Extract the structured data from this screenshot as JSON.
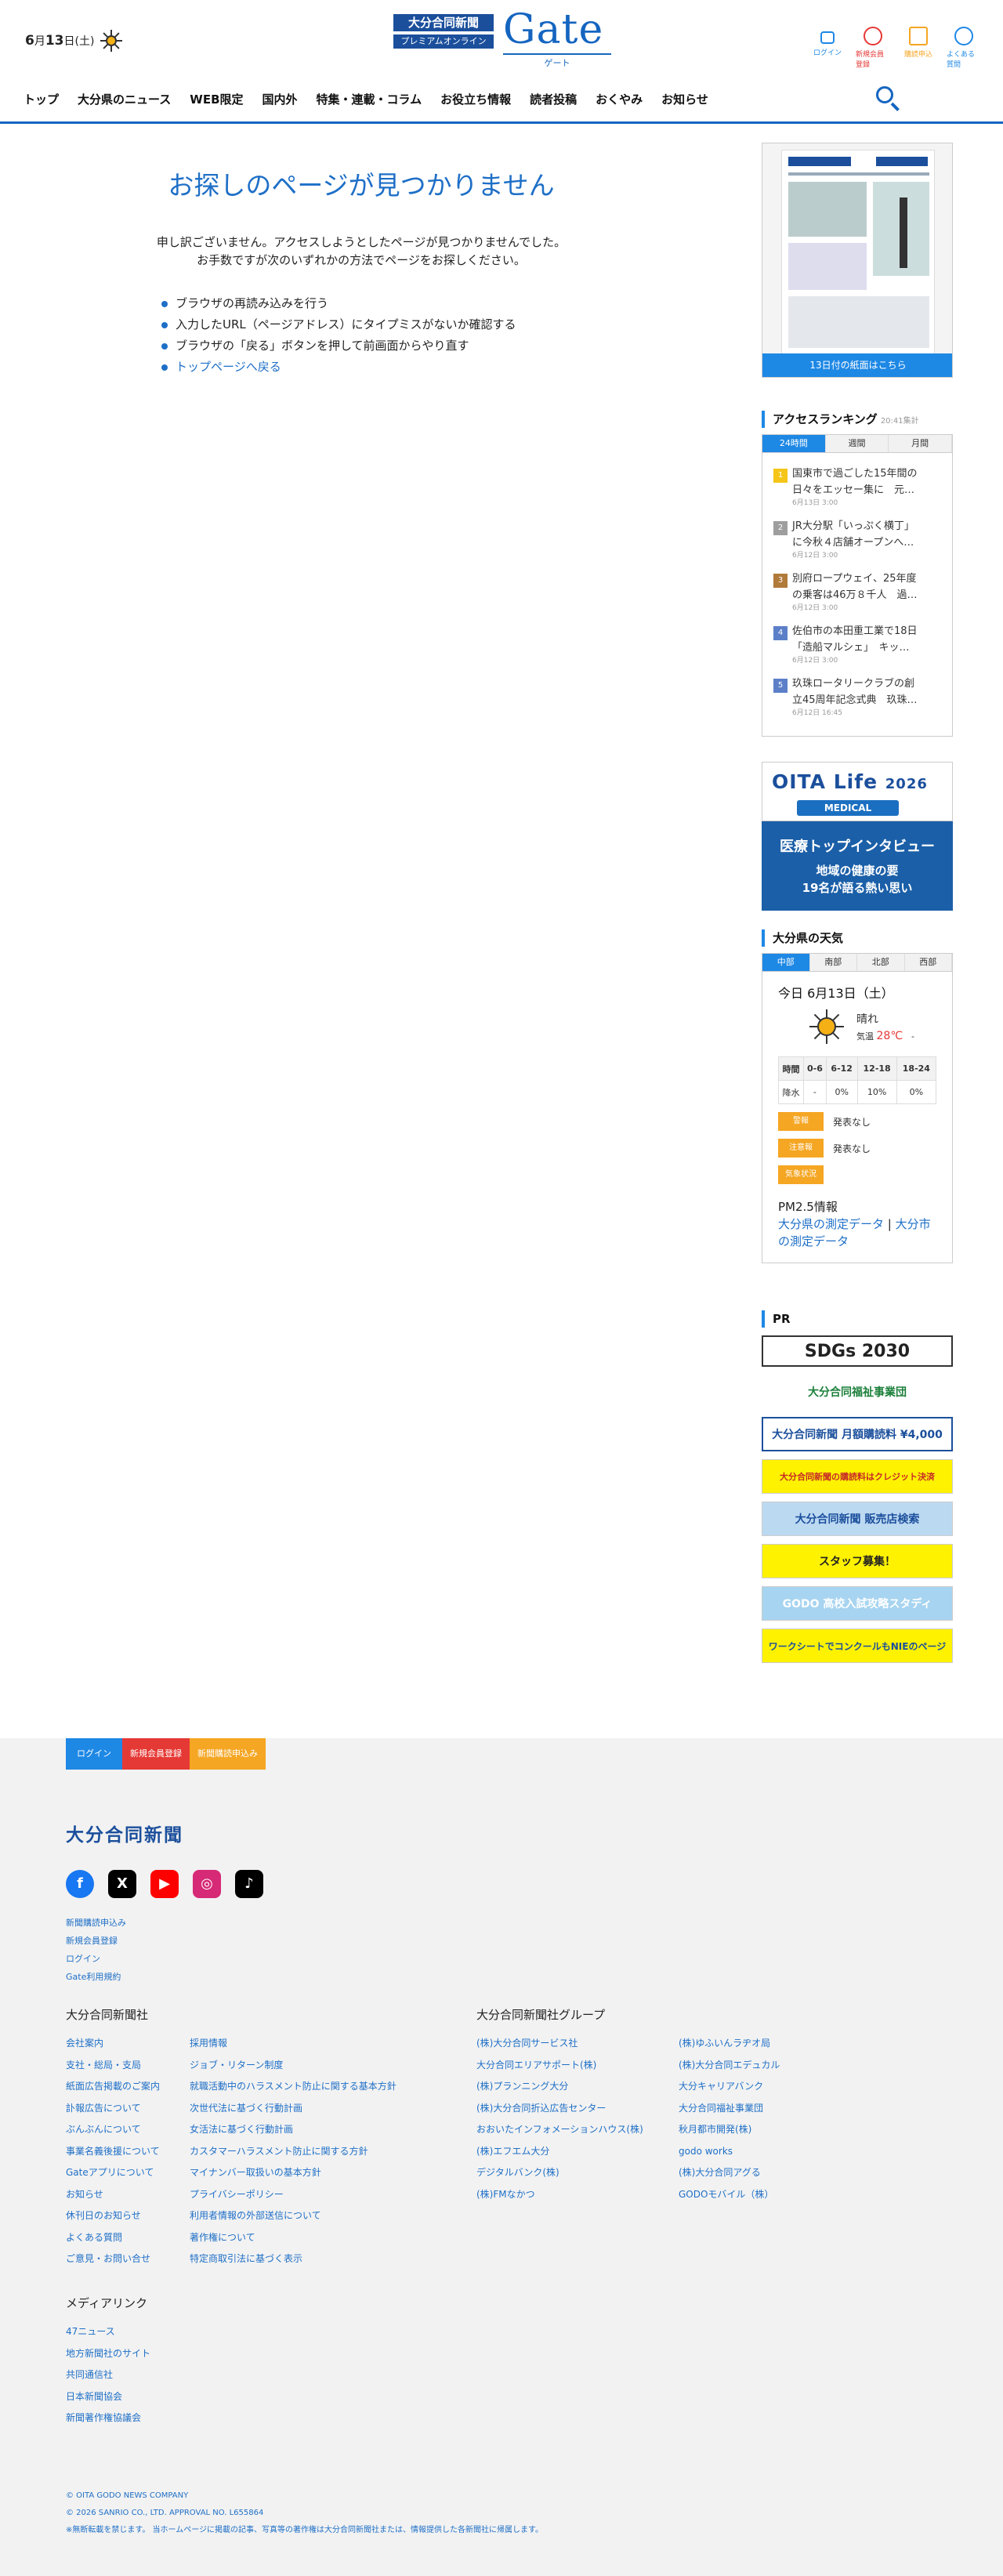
{
  "header": {
    "date_month": "6",
    "date_month_unit": "月",
    "date_day": "13",
    "date_day_unit": "日",
    "date_weekday": "(土)",
    "logo_newspaper": "大分合同新聞",
    "logo_sub": "プレミアムオンライン",
    "logo_gate": "Gate",
    "logo_gate_kana": "ゲート",
    "icons": [
      {
        "label": "ログイン",
        "icon": "lock-icon",
        "color": "#1e88e5"
      },
      {
        "label": "新規会員登録",
        "icon": "check-circle-icon",
        "color": "#e53935"
      },
      {
        "label": "購読申込",
        "icon": "newspaper-icon",
        "color": "#f5a623"
      },
      {
        "label": "よくある質問",
        "icon": "question-icon",
        "color": "#1e88e5"
      }
    ]
  },
  "nav": [
    "トップ",
    "大分県のニュース",
    "WEB限定",
    "国内外",
    "特集・連載・コラム",
    "お役立ち情報",
    "読者投稿",
    "おくやみ",
    "お知らせ"
  ],
  "not_found": {
    "title": "お探しのページが見つかりません",
    "desc_line1": "申し訳ございません。アクセスしようとしたページが見つかりませんでした。",
    "desc_line2": "お手数ですが次のいずれかの方法でページをお探しください。",
    "items": [
      "ブラウザの再読み込みを行う",
      "入力したURL（ページアドレス）にタイプミスがないか確認する",
      "ブラウザの「戻る」ボタンを押して前画面からやり直す"
    ],
    "back_link": "トップページへ戻る"
  },
  "sidebar": {
    "paper_caption": "13日付の紙面はこちら",
    "ranking_title": "アクセスランキング",
    "ranking_note": "20:41集計",
    "ranking_tabs": [
      "24時間",
      "週間",
      "月間"
    ],
    "ranking": [
      {
        "no": "1",
        "title1": "国東市で過ごした15年間の",
        "title2": "日々をエッセー集に　元…",
        "date": "6月13日 3:00",
        "color": "#f5c518"
      },
      {
        "no": "2",
        "title1": "JR大分駅「いっぷく横丁」",
        "title2": "に今秋４店舗オープンへ…",
        "date": "6月12日 3:00",
        "color": "#9e9e9e"
      },
      {
        "no": "3",
        "title1": "別府ロープウェイ、25年度",
        "title2": "の乗客は46万８千人　過…",
        "date": "6月12日 3:00",
        "color": "#b07a3a"
      },
      {
        "no": "4",
        "title1": "佐伯市の本田重工業で18日",
        "title2": "「造船マルシェ」　キッ…",
        "date": "6月12日 3:00",
        "color": "#5c7fc8"
      },
      {
        "no": "5",
        "title1": "玖珠ロータリークラブの創",
        "title2": "立45周年記念式典　玖珠…",
        "date": "6月12日 16:45",
        "color": "#5c7fc8"
      }
    ],
    "oita_life_title": "OITA Life",
    "oita_life_year": "2026",
    "oita_life_tag": "MEDICAL",
    "oita_life_main": "医療トップインタビュー",
    "oita_life_sub1": "地域の健康の要",
    "oita_life_sub2": "19名が語る熱い思い",
    "weather_title": "大分県の天気",
    "weather_tabs": [
      "中部",
      "南部",
      "北部",
      "西部"
    ],
    "weather_date": "今日 6月13日（土）",
    "weather_cond": "晴れ",
    "weather_temp_label": "気温",
    "weather_temp": "28℃",
    "weather_temp_sep": "-",
    "weather_table_head": [
      "時間",
      "0-6",
      "6-12",
      "12-18",
      "18-24"
    ],
    "weather_table_row": [
      "降水",
      "-",
      "0%",
      "10%",
      "0%"
    ],
    "alerts": [
      {
        "badge": "警報",
        "text": "発表なし"
      },
      {
        "badge": "注意報",
        "text": "発表なし"
      },
      {
        "badge": "気象状況",
        "text": ""
      }
    ],
    "pm_title": "PM2.5情報",
    "pm_link1": "大分県の測定データ",
    "pm_sep": "|",
    "pm_link2a": "大分市",
    "pm_link2b": "の測定データ",
    "pr_title": "PR",
    "banners": [
      "SDGs 2030",
      "大分合同福祉事業団",
      "大分合同新聞 月額購読料 ¥4,000",
      "大分合同新聞の購読料はクレジット決済",
      "大分合同新聞 販売店検索",
      "スタッフ募集！",
      "GODO 高校入試攻略スタディ",
      "ワークシートでコンクールもNIEのページ"
    ]
  },
  "footer": {
    "buttons": [
      {
        "label": "ログイン",
        "color": "#1e88e5"
      },
      {
        "label": "新規会員登録",
        "color": "#e53935"
      },
      {
        "label": "新聞購読申込み",
        "color": "#f5a623"
      }
    ],
    "logo": "大分合同新聞",
    "social": [
      "facebook-icon",
      "x-icon",
      "youtube-icon",
      "instagram-icon",
      "tiktok-icon"
    ],
    "small_links": [
      "新聞購読申込み",
      "新規会員登録",
      "ログイン",
      "Gate利用規約"
    ],
    "company_title": "大分合同新聞社",
    "company_col1": [
      "会社案内",
      "支社・総局・支局",
      "紙面広告掲載のご案内",
      "訃報広告について",
      "ぶんぶんについて",
      "事業名義後援について",
      "Gateアプリについて",
      "お知らせ",
      "休刊日のお知らせ",
      "よくある質問",
      "ご意見・お問い合せ"
    ],
    "company_col2": [
      "採用情報",
      "ジョブ・リターン制度",
      "就職活動中のハラスメント防止に関する基本方針",
      "次世代法に基づく行動計画",
      "女活法に基づく行動計画",
      "カスタマーハラスメント防止に関する方針",
      "マイナンバー取扱いの基本方針",
      "プライバシーポリシー",
      "利用者情報の外部送信について",
      "著作権について",
      "特定商取引法に基づく表示"
    ],
    "group_title": "大分合同新聞社グループ",
    "group_col1": [
      "(株)大分合同サービス社",
      "大分合同エリアサポート(株)",
      "(株)プランニング大分",
      "(株)大分合同折込広告センター",
      "おおいたインフォメーションハウス(株)",
      "(株)エフエム大分",
      "デジタルバンク(株)",
      "(株)FMなかつ"
    ],
    "group_col2": [
      "(株)ゆふいんラヂオ局",
      "(株)大分合同エデュカル",
      "大分キャリアバンク",
      "大分合同福祉事業団",
      "秋月都市開発(株)",
      "godo works",
      "(株)大分合同アグる",
      "GODOモバイル（株）"
    ],
    "media_title": "メディアリンク",
    "media_links": [
      "47ニュース",
      "地方新聞社のサイト",
      "共同通信社",
      "日本新聞協会",
      "新聞著作権協議会"
    ],
    "copy1": "© OITA GODO NEWS COMPANY",
    "copy2": "© 2026 SANRIO CO., LTD. APPROVAL NO. L655864",
    "copy3": "※無断転載を禁じます。 当ホームページに掲載の記事、写真等の著作権は大分合同新聞社または、情報提供した各新聞社に帰属します。"
  }
}
